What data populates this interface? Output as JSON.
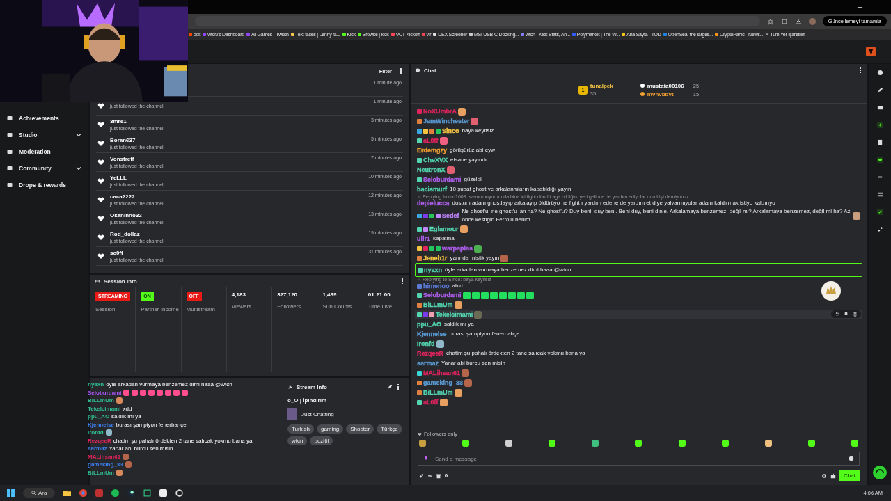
{
  "browser": {
    "update_button": "Güncellemeyi tamamla",
    "bookmarks": [
      {
        "label": "ddit",
        "color": "#ff4500"
      },
      {
        "label": "wtcN's Dashboard",
        "color": "#9146ff"
      },
      {
        "label": "All Games - Twitch",
        "color": "#9146ff"
      },
      {
        "label": "Text faces | Lenny fa...",
        "color": "#f2c94c"
      },
      {
        "label": "Kick",
        "color": "#53fc18"
      },
      {
        "label": "Browse | kick",
        "color": "#53fc18"
      },
      {
        "label": "VCT Kickoff",
        "color": "#ff4655"
      },
      {
        "label": "vlr",
        "color": "#ff4655"
      },
      {
        "label": "DEX Screener",
        "color": "#dddddd"
      },
      {
        "label": "MSI USB-C Docking...",
        "color": "#cccccc"
      },
      {
        "label": "wtcn - Kick Stats, An...",
        "color": "#8080ff"
      },
      {
        "label": "Polymarket | The W...",
        "color": "#2e5cff"
      },
      {
        "label": "Ana Sayfa - TOD",
        "color": "#f5c518"
      },
      {
        "label": "OpenSea, the larges...",
        "color": "#2081e2"
      },
      {
        "label": "CryptoPanic - News...",
        "color": "#f7931a"
      }
    ],
    "more": "»",
    "all_bookmarks": "Tüm Yer İşaretleri"
  },
  "sidebar": {
    "items": [
      {
        "label": "Achievements",
        "expandable": false
      },
      {
        "label": "Studio",
        "expandable": true
      },
      {
        "label": "Moderation",
        "expandable": false
      },
      {
        "label": "Community",
        "expandable": true
      },
      {
        "label": "Drops & rewards",
        "expandable": false
      }
    ]
  },
  "activity": {
    "filter": "Filter",
    "items": [
      {
        "time": "1 minute ago"
      },
      {
        "action": "just followed the channel",
        "time": "1 minute ago"
      },
      {
        "name": "3mre1",
        "action": "just followed the channel",
        "time": "3 minutes ago"
      },
      {
        "name": "Boran637",
        "action": "just followed the channel",
        "time": "5 minutes ago"
      },
      {
        "name": "Vonstreff",
        "action": "just followed the channel",
        "time": "7 minutes ago"
      },
      {
        "name": "YeLLL",
        "action": "just followed the channel",
        "time": "10 minutes ago"
      },
      {
        "name": "caca2222",
        "action": "just followed the channel",
        "time": "12 minutes ago"
      },
      {
        "name": "Okaninho32",
        "action": "just followed the channel",
        "time": "13 minutes ago"
      },
      {
        "name": "Rod_dollaz",
        "action": "just followed the channel",
        "time": "19 minutes ago"
      },
      {
        "name": "sc0ff",
        "action": "just followed the channel",
        "time": "31 minutes ago"
      }
    ]
  },
  "session_info": {
    "title": "Session Info",
    "stats": [
      {
        "kind": "badge",
        "value": "STREAMING",
        "color": "#e91916",
        "label": "Session"
      },
      {
        "kind": "badge",
        "value": "ON",
        "color": "#53fc18",
        "label": "Partner Income"
      },
      {
        "kind": "badge",
        "value": "OFF",
        "color": "#e91916",
        "label": "Multistream"
      },
      {
        "kind": "number",
        "value": "4,183",
        "label": "Viewers"
      },
      {
        "kind": "number",
        "value": "327,120",
        "label": "Followers"
      },
      {
        "kind": "number",
        "value": "1,489",
        "label": "Sub Counts"
      },
      {
        "kind": "number",
        "value": "01:21:00",
        "label": "Time Live"
      }
    ]
  },
  "stream_info": {
    "title": "Stream Info",
    "stream_title": "o_O | İpindirim",
    "category": "Just Chatting",
    "tags": [
      "Turkish",
      "gaming",
      "Shooter",
      "Türkçe",
      "wtcn",
      "pozitif"
    ]
  },
  "overlay_chat": [
    {
      "user": "nyaxn",
      "color": "#2fbf8f",
      "text": "öyle arkadan vurmaya benzemez dimi haaa @wtcn"
    },
    {
      "user": "Seloburdami",
      "color": "#a855f7",
      "emotes": [
        {
          "color": "#ff4d8d"
        },
        {
          "color": "#ff4d8d"
        },
        {
          "color": "#ff4d8d"
        },
        {
          "color": "#ff4d8d"
        },
        {
          "color": "#ff4d8d"
        },
        {
          "color": "#ff4d8d"
        },
        {
          "color": "#ff4d8d"
        },
        {
          "color": "#ff4d8d"
        }
      ]
    },
    {
      "user": "BiLLmUm",
      "color": "#2fbf8f",
      "emotes": [
        {
          "color": "#d9895b"
        }
      ]
    },
    {
      "user": "Tekelcimami",
      "color": "#2fbf8f",
      "text": "xdd"
    },
    {
      "user": "ppu_AO",
      "color": "#2fbf8f",
      "text": "saldık mı ya"
    },
    {
      "user": "Kjennelse",
      "color": "#3b82f6",
      "text": "burası şampiyon fenerbahçe"
    },
    {
      "user": "Ironfd",
      "color": "#2fbf8f",
      "emotes": [
        {
          "color": "#8fb8c8"
        }
      ]
    },
    {
      "user": "RezqeeR",
      "color": "#e0245e",
      "text": "chatim şu pahalı ördekten 2 tane salıcak yokmu bana ya"
    },
    {
      "user": "sarmaz",
      "color": "#3b82f6",
      "text": "Yanar abi burcu sen misin"
    },
    {
      "user": "MALihsan61",
      "color": "#e0245e",
      "emotes": [
        {
          "color": "#b5654a"
        }
      ]
    },
    {
      "user": "gameking_33",
      "color": "#3b82f6",
      "emotes": [
        {
          "color": "#b5654a"
        }
      ]
    },
    {
      "user": "BiLLmUm",
      "color": "#2fbf8f",
      "emotes": [
        {
          "color": "#d9895b"
        }
      ]
    }
  ],
  "chat": {
    "title": "Chat",
    "leaderboard": [
      {
        "rank": "1",
        "user": "tunalpek",
        "count": "35",
        "color": "#f5c542"
      },
      {
        "user": "mustafa00106",
        "count": "25",
        "color": "#ffffff"
      },
      {
        "user": "mvhvbbvt",
        "count": "15",
        "color": "#f0a030"
      }
    ],
    "messages": [
      {
        "kind": "plain",
        "user": "NoXUmbrA",
        "color": "#e0245e",
        "badges": [
          {
            "color": "#e0245e"
          }
        ],
        "emotes": [
          {
            "color": "#e8a060"
          }
        ]
      },
      {
        "kind": "plain",
        "user": "JamWinchester",
        "color": "#5b9bd5",
        "badges": [
          {
            "color": "#e08040"
          }
        ],
        "emotes": [
          {
            "color": "#e06070"
          }
        ]
      },
      {
        "kind": "plain",
        "user": "Sinco",
        "color": "#f5c542",
        "badges": [
          {
            "color": "#3aa7e0"
          },
          {
            "color": "#f5c542"
          },
          {
            "color": "#e08040"
          },
          {
            "color": "#22c55e"
          }
        ],
        "text": "baya keyifsiz"
      },
      {
        "kind": "plain",
        "user": "aL0ff",
        "color": "#e0245e",
        "badges": [
          {
            "color": "#53d6b0"
          }
        ],
        "emotes": [
          {
            "color": "#f06080"
          }
        ]
      },
      {
        "kind": "plain",
        "user": "Erdemgzy",
        "color": "#f0a030",
        "text": "görüşürüz abi eyw"
      },
      {
        "kind": "plain",
        "user": "CheXVX",
        "color": "#53d6b0",
        "badges": [
          {
            "color": "#53d6b0"
          }
        ],
        "text": "efsane yayındı"
      },
      {
        "kind": "plain",
        "user": "NeutronX",
        "color": "#53d6b0",
        "emotes": [
          {
            "color": "#e06070"
          }
        ]
      },
      {
        "kind": "plain",
        "user": "Seloburdami",
        "color": "#b060f0",
        "badges": [
          {
            "color": "#53d6b0"
          }
        ],
        "text": "güzeldi"
      },
      {
        "kind": "plain",
        "user": "bacismurf",
        "color": "#53d6b0",
        "text": "10 şubat ghost ve arkalanmların kapatıldığı yayın"
      },
      {
        "kind": "plain",
        "reply": "Replying to mrt1609: savunmuyorum da bina içi fight döndü aga bildiğin. yeri gelince de yardım ediyolar ona bişi demiyonuz",
        "user": "depielucca",
        "color": "#b060f0",
        "text": "dostum adam ghostlayıp arkalayıp öldürüyo ne fight ı yardım edene de yardım et diye yalvarmıyolar adam kaldırmak istiyo kaldırıyo"
      },
      {
        "kind": "plain",
        "user": "Sedef",
        "color": "#c084fc",
        "badges": [
          {
            "color": "#3aa7e0"
          },
          {
            "color": "#7c3aed"
          },
          {
            "color": "#22c55e"
          },
          {
            "color": "#c084fc"
          }
        ],
        "text": "Ne ghost'u, ne ghost'u lan ha? Ne ghost'u? Duy beni, duy beni. Beni duy, beni dinle. Arkalamaya benzemez, değil mi? Arkalamaya benzemez, değil mi ha? Az önce kestiğin Ferrolu benim.",
        "emotes": [
          {
            "color": "#c8a080"
          }
        ]
      },
      {
        "kind": "plain",
        "user": "Eglamour",
        "color": "#53d6b0",
        "badges": [
          {
            "color": "#53d6b0"
          },
          {
            "color": "#c084fc"
          }
        ],
        "emotes": [
          {
            "color": "#e8a060"
          }
        ]
      },
      {
        "kind": "plain",
        "user": "ullr1",
        "color": "#b060f0",
        "text": "kapatma"
      },
      {
        "kind": "plain",
        "user": "warpaplas",
        "color": "#b060f0",
        "badges": [
          {
            "color": "#f5c542"
          },
          {
            "color": "#e0245e"
          },
          {
            "color": "#22c55e"
          },
          {
            "color": "#22c55e"
          }
        ],
        "emotes": [
          {
            "color": "#4caf50"
          }
        ]
      },
      {
        "kind": "plain",
        "user": "Jeneb1r",
        "color": "#f5c542",
        "badges": [
          {
            "color": "#e08040"
          }
        ],
        "text": "yarında mistik yayın",
        "emotes": [
          {
            "color": "#b5654a"
          }
        ]
      },
      {
        "kind": "mention",
        "user": "nyaxn",
        "color": "#53d6b0",
        "badges": [
          {
            "color": "#53d6b0"
          }
        ],
        "text": "öyle arkadan vurmaya benzemez dimi haaa @wtcn"
      },
      {
        "kind": "plain",
        "reply": "Replying to Sinco: baya keyifsiz",
        "user": "himenoo",
        "color": "#5b7bd5",
        "badges": [
          {
            "color": "#5b7bd5"
          }
        ],
        "text": "abid"
      },
      {
        "kind": "plain",
        "user": "Seloburdami",
        "color": "#b060f0",
        "badges": [
          {
            "color": "#53d6b0"
          }
        ],
        "emotes": [
          {
            "color": "#22e05e"
          },
          {
            "color": "#22e05e"
          },
          {
            "color": "#22e05e"
          },
          {
            "color": "#22e05e"
          },
          {
            "color": "#22e05e"
          },
          {
            "color": "#22e05e"
          },
          {
            "color": "#22e05e"
          },
          {
            "color": "#22e05e"
          }
        ]
      },
      {
        "kind": "plain",
        "user": "BiLLmUm",
        "color": "#53d6b0",
        "badges": [
          {
            "color": "#e08040"
          }
        ],
        "emotes": [
          {
            "color": "#e8a060"
          }
        ]
      },
      {
        "kind": "hover",
        "user": "Tekelcimami",
        "color": "#53d6b0",
        "badges": [
          {
            "color": "#53d6b0"
          },
          {
            "color": "#7c3aed"
          },
          {
            "color": "#f0a0b0"
          }
        ],
        "emotes": [
          {
            "color": "#6b6b55"
          }
        ]
      },
      {
        "kind": "plain",
        "user": "ppu_AO",
        "color": "#53d6b0",
        "text": "saldık mı ya"
      },
      {
        "kind": "plain",
        "user": "Kjennelse",
        "color": "#5b9bd5",
        "text": "burası şampiyon fenerbahçe"
      },
      {
        "kind": "plain",
        "user": "Ironfd",
        "color": "#53d6b0",
        "emotes": [
          {
            "color": "#8fb8c8"
          }
        ]
      },
      {
        "kind": "plain",
        "user": "RezqeeR",
        "color": "#e0245e",
        "text": "chatim şu pahalı ördekten 2 tane salıcak yokmu bana ya"
      },
      {
        "kind": "plain",
        "user": "sarmaz",
        "color": "#5b9bd5",
        "text": "Yanar abi burcu sen misin"
      },
      {
        "kind": "plain",
        "user": "MALihsan61",
        "color": "#e0245e",
        "badges": [
          {
            "color": "#3ad6d6"
          }
        ],
        "emotes": [
          {
            "color": "#b5654a"
          }
        ]
      },
      {
        "kind": "plain",
        "user": "gameking_33",
        "color": "#5b9bd5",
        "badges": [
          {
            "color": "#e08040"
          }
        ],
        "emotes": [
          {
            "color": "#b5654a"
          }
        ]
      },
      {
        "kind": "plain",
        "user": "BiLLmUm",
        "color": "#53d6b0",
        "badges": [
          {
            "color": "#e08040"
          }
        ],
        "emotes": [
          {
            "color": "#e8a060"
          }
        ]
      },
      {
        "kind": "plain",
        "user": "aL0ff",
        "color": "#e0245e",
        "badges": [
          {
            "color": "#53d6b0"
          }
        ],
        "emotes": [
          {
            "color": "#e8a060"
          }
        ]
      }
    ],
    "followers_only": "Followers only",
    "emote_bar": [
      {
        "color": "#c8a040"
      },
      {
        "color": "#53fc18"
      },
      {
        "color": "#d0d0d0"
      },
      {
        "color": "#53fc18"
      },
      {
        "color": "#40c080"
      },
      {
        "color": "#53fc18"
      },
      {
        "color": "#53fc18"
      },
      {
        "color": "#53fc18"
      },
      {
        "color": "#f0c080"
      },
      {
        "color": "#53fc18"
      },
      {
        "color": "#53fc18"
      }
    ],
    "input": {
      "placeholder": "Send a message"
    },
    "points": "∞",
    "store_count": "0",
    "send_button": "Chat"
  },
  "taskbar": {
    "search": "Ara",
    "time": "4:06 AM"
  }
}
